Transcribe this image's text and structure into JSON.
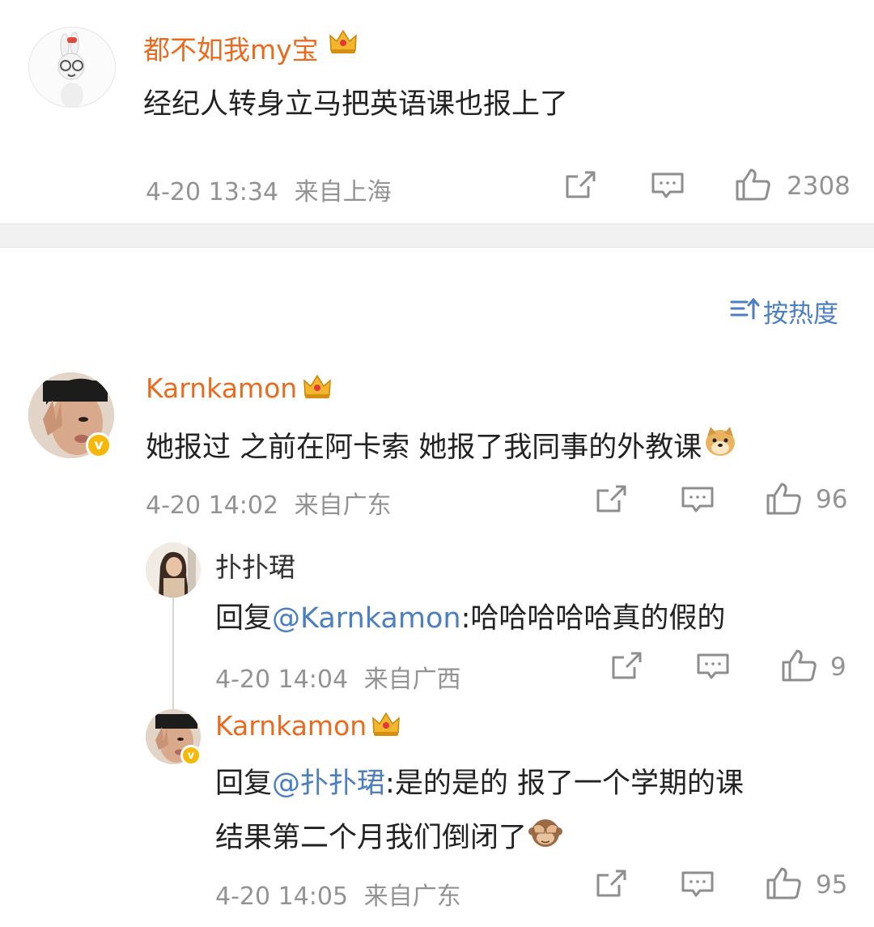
{
  "comments": [
    {
      "username": "都不如我my宝",
      "text": "经纪人转身立马把英语课也报上了",
      "timestamp": "4-20 13:34",
      "location": "来自上海",
      "likes": "2308"
    },
    {
      "username": "Karnkamon",
      "text": "她报过 之前在阿卡索 她报了我同事的外教课",
      "timestamp": "4-20 14:02",
      "location": "来自广东",
      "likes": "96",
      "replies": [
        {
          "username": "扑扑珺",
          "reply_prefix": "回复",
          "mention": "@Karnkamon",
          "text": ":哈哈哈哈哈真的假的",
          "timestamp": "4-20 14:04",
          "location": "来自广西",
          "likes": "9"
        },
        {
          "username": "Karnkamon",
          "reply_prefix": "回复",
          "mention": "@扑扑珺",
          "text": ":是的是的 报了一个学期的课",
          "text_line2": "结果第二个月我们倒闭了",
          "timestamp": "4-20 14:05",
          "location": "来自广东",
          "likes": "95"
        }
      ]
    }
  ],
  "sort": {
    "label": "按热度"
  },
  "colors": {
    "username": "#e86b1f",
    "mention": "#4c7fbf",
    "meta": "#939393",
    "verified": "#f6b90a"
  },
  "icons": [
    "crown-icon",
    "share-icon",
    "comment-icon",
    "like-icon",
    "sort-icon",
    "doge-emoji",
    "see-no-evil-monkey-emoji",
    "verified-badge-icon"
  ]
}
